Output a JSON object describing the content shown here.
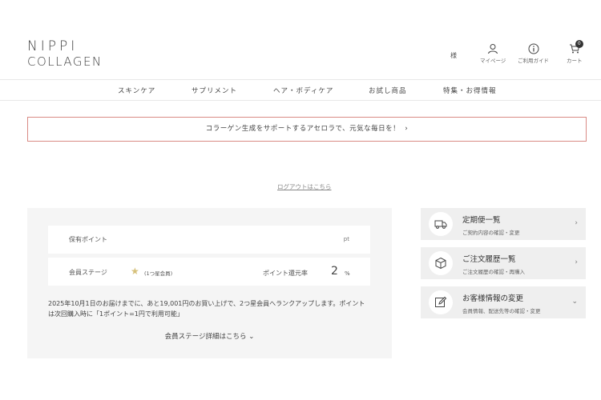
{
  "logo": {
    "line1": "NIPPI",
    "line2": "COLLAGEN"
  },
  "header": {
    "user_suffix": "様",
    "mypage": "マイページ",
    "guide": "ご利用ガイド",
    "cart": "カート",
    "cart_count": "0"
  },
  "nav": {
    "items": [
      "スキンケア",
      "サプリメント",
      "ヘア・ボディケア",
      "お試し商品",
      "特集・お得情報"
    ]
  },
  "banner": {
    "text": "コラーゲン生成をサポートするアセロラで、元気な毎日を！",
    "chevron": "›"
  },
  "logout": "ログアウトはこちら",
  "points": {
    "label": "保有ポイント",
    "unit": "pt",
    "stage_label": "会員ステージ",
    "star": "★",
    "stage_value": "(1つ星会員)",
    "rate_label": "ポイント還元率",
    "rate_value": "2",
    "rate_unit": "%",
    "message": "2025年10月1日のお届けまでに、あと19,001円のお買い上げで、2つ星会員へランクアップします。ポイントは次回購入時に「1ポイント=1円で利用可能」",
    "detail_link": "会員ステージ詳細はこちら ⌄"
  },
  "side_menu": [
    {
      "title": "定期便一覧",
      "sub": "ご契約内容の確認・変更",
      "chevron": "›",
      "icon": "truck-icon"
    },
    {
      "title": "ご注文履歴一覧",
      "sub": "ご注文履歴の確認・再購入",
      "chevron": "›",
      "icon": "box-icon"
    },
    {
      "title": "お客様情報の変更",
      "sub": "会員情報、配送先等の確認・変更",
      "chevron": "⌄",
      "icon": "edit-icon"
    }
  ]
}
